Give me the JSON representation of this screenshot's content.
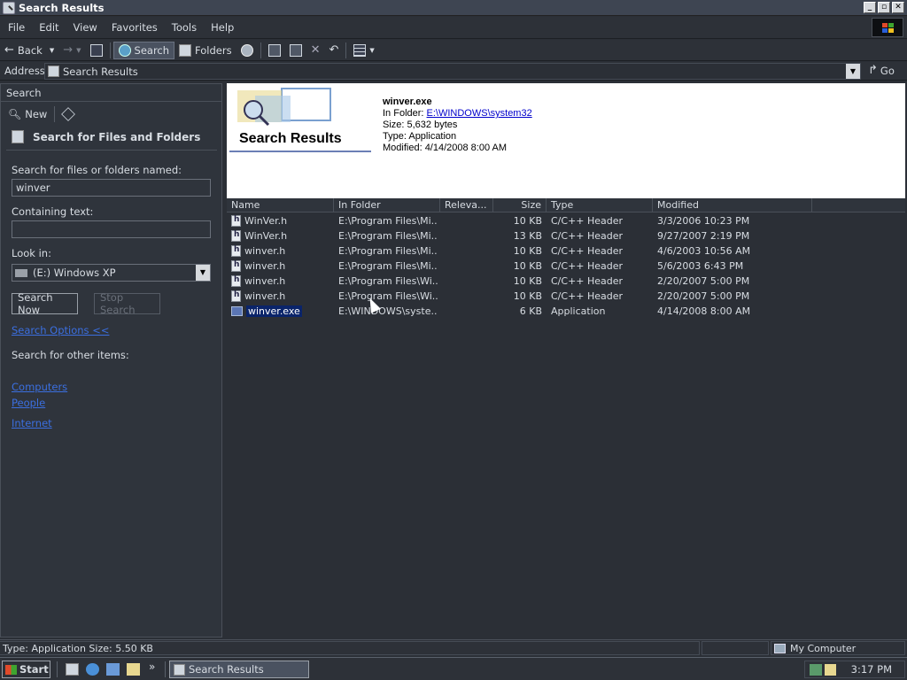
{
  "window": {
    "title": "Search Results"
  },
  "menu": [
    "File",
    "Edit",
    "View",
    "Favorites",
    "Tools",
    "Help"
  ],
  "toolbar": {
    "back": "Back",
    "search": "Search",
    "folders": "Folders"
  },
  "address": {
    "label": "Address",
    "value": "Search Results",
    "go": "Go"
  },
  "left_pane": {
    "header": "Search",
    "new": "New",
    "title": "Search for Files and Folders",
    "named_label": "Search for files or folders named:",
    "named_value": "winver",
    "containing_label": "Containing text:",
    "containing_value": "",
    "lookin_label": "Look in:",
    "lookin_value": "(E:) Windows XP",
    "search_now": "Search Now",
    "stop_search": "Stop Search",
    "search_options": "Search Options <<",
    "other_items": "Search for other items:",
    "link_computers": "Computers",
    "link_people": "People",
    "link_internet": "Internet"
  },
  "banner": {
    "title": "Search Results",
    "file": "winver.exe",
    "in_folder_label": "In Folder: ",
    "in_folder_link": "E:\\WINDOWS\\system32",
    "size": "Size: 5,632 bytes",
    "type": "Type: Application",
    "modified": "Modified: 4/14/2008 8:00 AM"
  },
  "columns": {
    "name": "Name",
    "folder": "In Folder",
    "relevance": "Releva...",
    "size": "Size",
    "type": "Type",
    "modified": "Modified"
  },
  "rows": [
    {
      "name": "WinVer.h",
      "folder": "E:\\Program Files\\Mi...",
      "size": "10 KB",
      "type": "C/C++ Header",
      "modified": "3/3/2006 10:23 PM"
    },
    {
      "name": "WinVer.h",
      "folder": "E:\\Program Files\\Mi...",
      "size": "13 KB",
      "type": "C/C++ Header",
      "modified": "9/27/2007 2:19 PM"
    },
    {
      "name": "winver.h",
      "folder": "E:\\Program Files\\Mi...",
      "size": "10 KB",
      "type": "C/C++ Header",
      "modified": "4/6/2003 10:56 AM"
    },
    {
      "name": "winver.h",
      "folder": "E:\\Program Files\\Mi...",
      "size": "10 KB",
      "type": "C/C++ Header",
      "modified": "5/6/2003 6:43 PM"
    },
    {
      "name": "winver.h",
      "folder": "E:\\Program Files\\Wi...",
      "size": "10 KB",
      "type": "C/C++ Header",
      "modified": "2/20/2007 5:00 PM"
    },
    {
      "name": "winver.h",
      "folder": "E:\\Program Files\\Wi...",
      "size": "10 KB",
      "type": "C/C++ Header",
      "modified": "2/20/2007 5:00 PM"
    },
    {
      "name": "winver.exe",
      "folder": "E:\\WINDOWS\\syste...",
      "size": "6 KB",
      "type": "Application",
      "modified": "4/14/2008 8:00 AM"
    }
  ],
  "status": {
    "left": "Type: Application Size: 5.50 KB",
    "right": "My Computer"
  },
  "taskbar": {
    "start": "Start",
    "task": "Search Results",
    "clock": "3:17 PM"
  }
}
